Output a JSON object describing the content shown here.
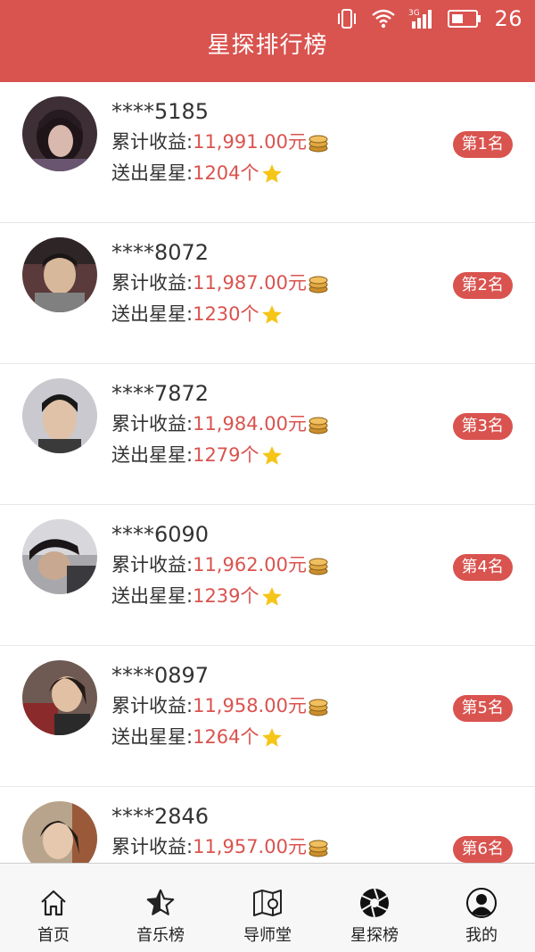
{
  "status_bar": {
    "time": "26",
    "icons": [
      "vibrate-icon",
      "wifi-icon",
      "3g-signal-icon",
      "battery-icon"
    ]
  },
  "header": {
    "title": "星探排行榜"
  },
  "labels": {
    "earnings": "累计收益:",
    "stars": "送出星星:",
    "currency_suffix": "元",
    "count_suffix": "个"
  },
  "colors": {
    "brand_red": "#d9534f",
    "value_red": "#d9534f",
    "text_dark": "#333333",
    "coin_gold": "#d9a441",
    "star_yellow": "#f5c518"
  },
  "entries": [
    {
      "id": "****5185",
      "earnings": "11,991.00",
      "stars": "1204",
      "rank": "第1名"
    },
    {
      "id": "****8072",
      "earnings": "11,987.00",
      "stars": "1230",
      "rank": "第2名"
    },
    {
      "id": "****7872",
      "earnings": "11,984.00",
      "stars": "1279",
      "rank": "第3名"
    },
    {
      "id": "****6090",
      "earnings": "11,962.00",
      "stars": "1239",
      "rank": "第4名"
    },
    {
      "id": "****0897",
      "earnings": "11,958.00",
      "stars": "1264",
      "rank": "第5名"
    },
    {
      "id": "****2846",
      "earnings": "11,957.00",
      "stars": "",
      "rank": "第6名"
    }
  ],
  "tabbar": {
    "tabs": [
      {
        "label": "首页",
        "icon": "home-icon"
      },
      {
        "label": "音乐榜",
        "icon": "star-outline-icon"
      },
      {
        "label": "导师堂",
        "icon": "map-pin-icon"
      },
      {
        "label": "星探榜",
        "icon": "aperture-icon"
      },
      {
        "label": "我的",
        "icon": "user-icon"
      }
    ],
    "active_index": 3
  }
}
